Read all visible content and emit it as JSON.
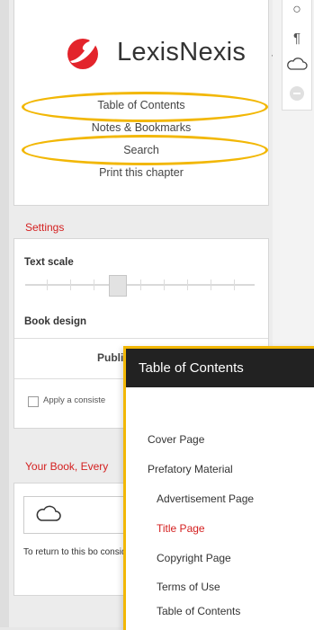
{
  "brand": {
    "name": "LexisNexis",
    "mark": "·",
    "logo_color": "#e3242b"
  },
  "menu": {
    "items": [
      {
        "label": "Table of Contents",
        "highlighted": true
      },
      {
        "label": "Notes & Bookmarks",
        "highlighted": false
      },
      {
        "label": "Search",
        "highlighted": true
      },
      {
        "label": "Print this chapter",
        "highlighted": false
      }
    ]
  },
  "settings": {
    "title": "Settings",
    "text_scale_label": "Text scale",
    "text_scale_level": 0.4,
    "book_design_label": "Book design",
    "book_design_value": "Publi",
    "apply_label": "Apply a consiste"
  },
  "book": {
    "title": "Your Book, Every",
    "help_text": "To return to this bo consider adding it t Explorer's favorites"
  },
  "toc": {
    "title": "Table of Contents",
    "items": [
      {
        "label": "Cover Page",
        "level": 0,
        "active": false
      },
      {
        "label": "Prefatory Material",
        "level": 0,
        "active": false
      },
      {
        "label": "Advertisement Page",
        "level": 1,
        "active": false
      },
      {
        "label": "Title Page",
        "level": 1,
        "active": true
      },
      {
        "label": "Copyright Page",
        "level": 1,
        "active": false
      },
      {
        "label": "Terms of Use",
        "level": 1,
        "active": false
      },
      {
        "label": "Table of Contents",
        "level": 1,
        "active": false
      }
    ]
  },
  "tools": [
    "circle-icon",
    "pilcrow-icon",
    "cloud-icon",
    "minus-icon"
  ],
  "tool_glyphs": {
    "circle": "○",
    "pilcrow": "¶"
  },
  "colors": {
    "highlight": "#f2b705",
    "accent_red": "#d41f1f",
    "toc_header_bg": "#222222"
  }
}
